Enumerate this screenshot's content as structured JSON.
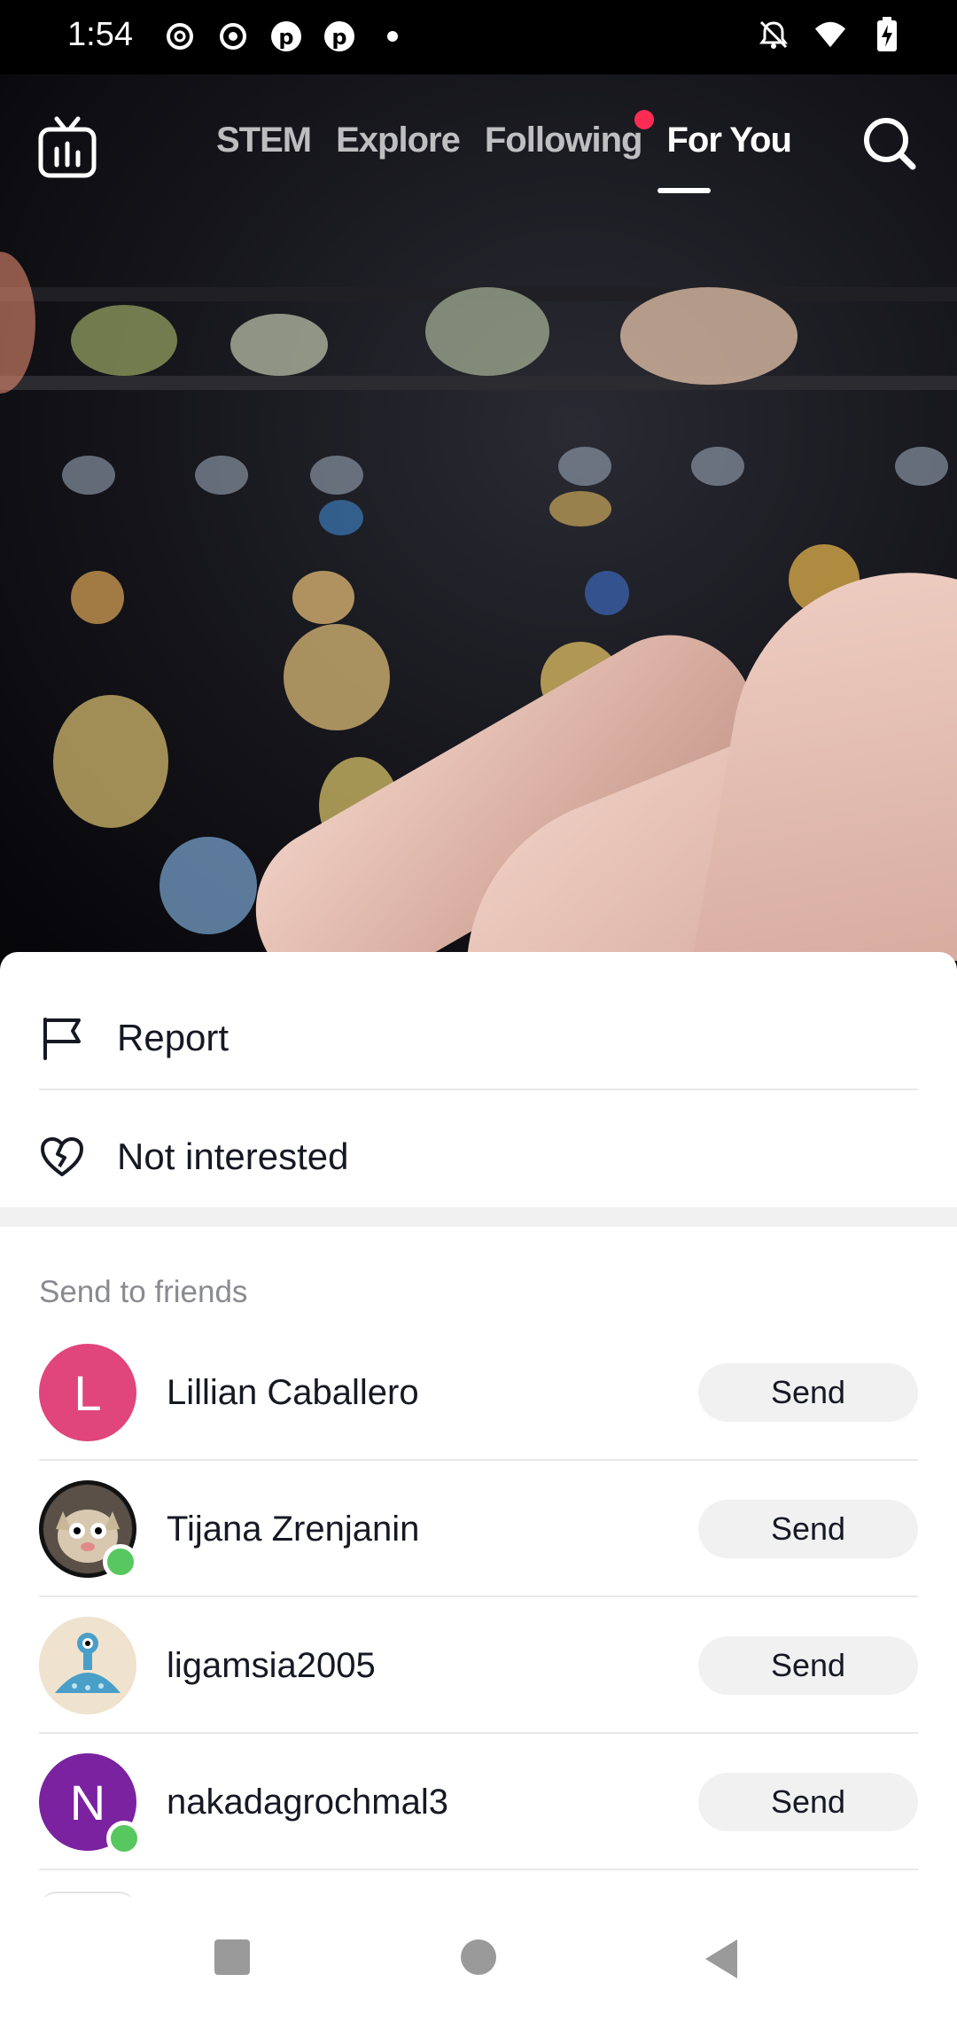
{
  "status_bar": {
    "time": "1:54",
    "left_icons": [
      "threads-icon",
      "record-icon",
      "pinterest-icon",
      "pinterest-icon",
      "dot-icon"
    ],
    "right_icons": [
      "bell-off-icon",
      "wifi-icon",
      "battery-charging-icon"
    ]
  },
  "top_nav": {
    "tabs": [
      {
        "label": "STEM",
        "active": false
      },
      {
        "label": "Explore",
        "active": false
      },
      {
        "label": "Following",
        "active": false,
        "has_dot": true
      },
      {
        "label": "For You",
        "active": true
      }
    ],
    "dot_color": "#fe2c55"
  },
  "sheet": {
    "actions": [
      {
        "label": "Report",
        "icon": "flag-icon"
      },
      {
        "label": "Not interested",
        "icon": "broken-heart-icon"
      }
    ],
    "section_title": "Send to friends",
    "friends": [
      {
        "name": "Lillian Caballero",
        "initial": "L",
        "avatar_color": "#e0457b",
        "online": false,
        "button": "Send"
      },
      {
        "name": "Tijana Zrenjanin",
        "initial": "",
        "avatar_color": "#7a6a5a",
        "online": true,
        "button": "Send"
      },
      {
        "name": "ligamsia2005",
        "initial": "",
        "avatar_color": "#efe3cf",
        "online": false,
        "button": "Send"
      },
      {
        "name": "nakadagrochmal3",
        "initial": "N",
        "avatar_color": "#7a22a0",
        "online": true,
        "button": "Send"
      }
    ]
  },
  "nav_bar": {
    "buttons": [
      "recents-square-icon",
      "home-circle-icon",
      "back-triangle-icon"
    ]
  }
}
